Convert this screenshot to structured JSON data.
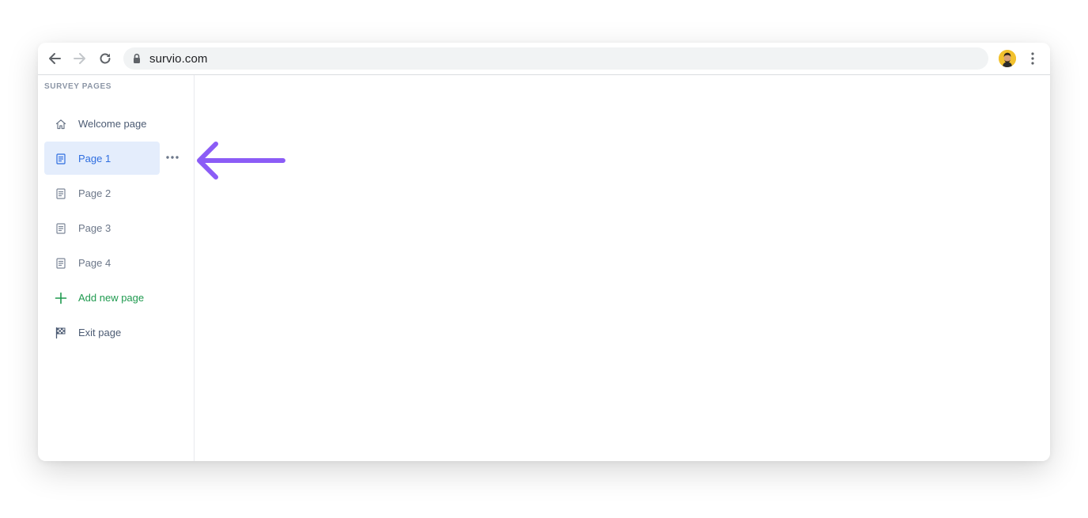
{
  "browser": {
    "url": "survio.com",
    "back_icon": "arrow-left-icon",
    "forward_icon": "arrow-right-icon",
    "reload_icon": "reload-icon",
    "lock_icon": "lock-icon",
    "menu_icon": "vertical-dots-icon"
  },
  "sidebar": {
    "title": "SURVEY PAGES",
    "items": [
      {
        "label": "Welcome page",
        "icon": "home-icon"
      },
      {
        "label": "Page 1",
        "icon": "page-icon",
        "active": true
      },
      {
        "label": "Page 2",
        "icon": "page-icon"
      },
      {
        "label": "Page 3",
        "icon": "page-icon"
      },
      {
        "label": "Page 4",
        "icon": "page-icon"
      },
      {
        "label": "Add new page",
        "icon": "plus-icon"
      },
      {
        "label": "Exit page",
        "icon": "checkered-flag-icon"
      }
    ],
    "more_icon": "more-horizontal-icon"
  },
  "colors": {
    "active_bg": "#e4edfc",
    "active_text": "#2f6ee0",
    "add_text": "#1f9a4f",
    "annotation_arrow": "#8b5cf6"
  }
}
